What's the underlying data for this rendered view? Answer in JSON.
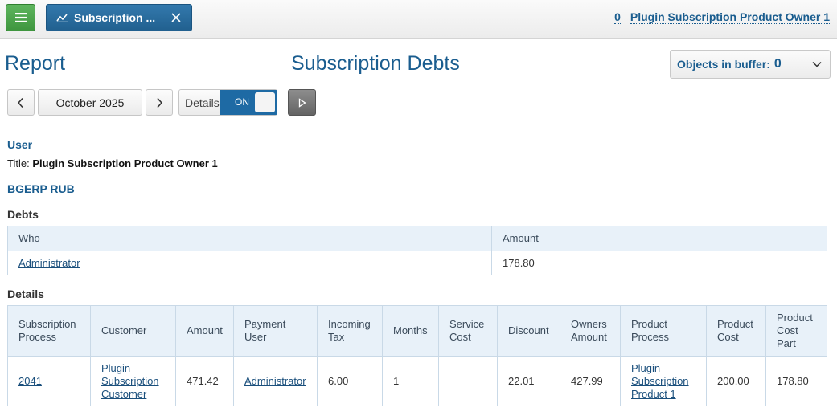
{
  "topbar": {
    "tab_label": "Subscription ...",
    "count": "0",
    "user": "Plugin Subscription Product Owner 1"
  },
  "header": {
    "report": "Report",
    "title": "Subscription Debts",
    "buffer_label": "Objects in buffer:",
    "buffer_count": "0"
  },
  "controls": {
    "month": "October 2025",
    "details_label": "Details",
    "toggle_state": "ON"
  },
  "user": {
    "heading": "User",
    "title_prefix": "Title:",
    "title_value": "Plugin Subscription Product Owner 1"
  },
  "currency": "BGERP RUB",
  "debts": {
    "heading": "Debts",
    "columns": [
      "Who",
      "Amount"
    ],
    "rows": [
      {
        "who": "Administrator",
        "amount": "178.80"
      }
    ]
  },
  "details": {
    "heading": "Details",
    "columns": [
      "Subscription Process",
      "Customer",
      "Amount",
      "Payment User",
      "Incoming Tax",
      "Months",
      "Service Cost",
      "Discount",
      "Owners Amount",
      "Product Process",
      "Product Cost",
      "Product Cost Part"
    ],
    "rows": [
      {
        "subscription_process": "2041",
        "customer": "Plugin Subscription Customer",
        "amount": "471.42",
        "payment_user": "Administrator",
        "incoming_tax": "6.00",
        "months": "1",
        "service_cost": "",
        "discount": "22.01",
        "owners_amount": "427.99",
        "product_process": "Plugin Subscription Product 1",
        "product_cost": "200.00",
        "product_cost_part": "178.80"
      }
    ]
  },
  "icons": {
    "menu": "hamburger-icon",
    "tab": "chart-line-icon",
    "close": "close-icon",
    "buffer": "chevron-down-icon",
    "prev": "chevron-left-icon",
    "next": "chevron-right-icon",
    "run": "play-icon"
  },
  "colors": {
    "accent": "#1a5d8f",
    "menu_green": "#4aa64a",
    "tab_blue": "#21608f",
    "table_header": "#e8f1f9"
  }
}
